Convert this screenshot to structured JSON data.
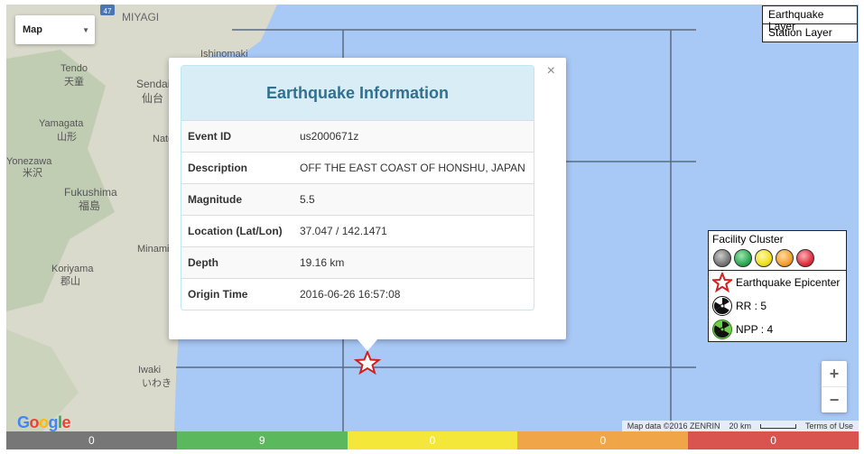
{
  "map": {
    "type_label": "Map",
    "place_labels": [
      "MIYAGI",
      "Ishinomaki",
      "Sendai",
      "仙台",
      "Yamagata",
      "山形",
      "Tendo",
      "天童",
      "Yonezawa",
      "米沢",
      "Fukushima",
      "福島",
      "Koriyama",
      "郡山",
      "Iwaki",
      "いわき",
      "Minami",
      "Nato"
    ],
    "road_shield": "47",
    "google_logo": "Google",
    "attribution": "Map data ©2016 ZENRIN",
    "scale_label": "20 km",
    "terms": "Terms of Use"
  },
  "layers": {
    "earthquake_label": "Earthquake Layer",
    "station_label": "Station Layer"
  },
  "popup": {
    "title": "Earthquake Information",
    "close_glyph": "×",
    "rows": [
      {
        "key": "Event ID",
        "value": "us2000671z"
      },
      {
        "key": "Description",
        "value": "OFF THE EAST COAST OF HONSHU, JAPAN"
      },
      {
        "key": "Magnitude",
        "value": "5.5"
      },
      {
        "key": "Location (Lat/Lon)",
        "value": "37.047 / 142.1471"
      },
      {
        "key": "Depth",
        "value": "19.16 km"
      },
      {
        "key": "Origin Time",
        "value": "2016-06-26 16:57:08"
      }
    ]
  },
  "legend": {
    "title": "Facility Cluster",
    "ball_colors": [
      "#777777",
      "#2eaa55",
      "#f0e020",
      "#f5a030",
      "#e03040"
    ],
    "epicenter_label": "Earthquake Epicenter",
    "rr_label": "RR : 5",
    "npp_label": "NPP : 4",
    "epicenter_icon": "star-icon",
    "rr_icon": "radiation-black-icon",
    "npp_icon": "radiation-green-icon"
  },
  "zoom": {
    "in": "+",
    "out": "−"
  },
  "status_bar": [
    {
      "count": "0",
      "color": "#777777"
    },
    {
      "count": "9",
      "color": "#5cb85c"
    },
    {
      "count": "0",
      "color": "#f5e63a"
    },
    {
      "count": "0",
      "color": "#f0a548"
    },
    {
      "count": "0",
      "color": "#d9534f"
    }
  ]
}
